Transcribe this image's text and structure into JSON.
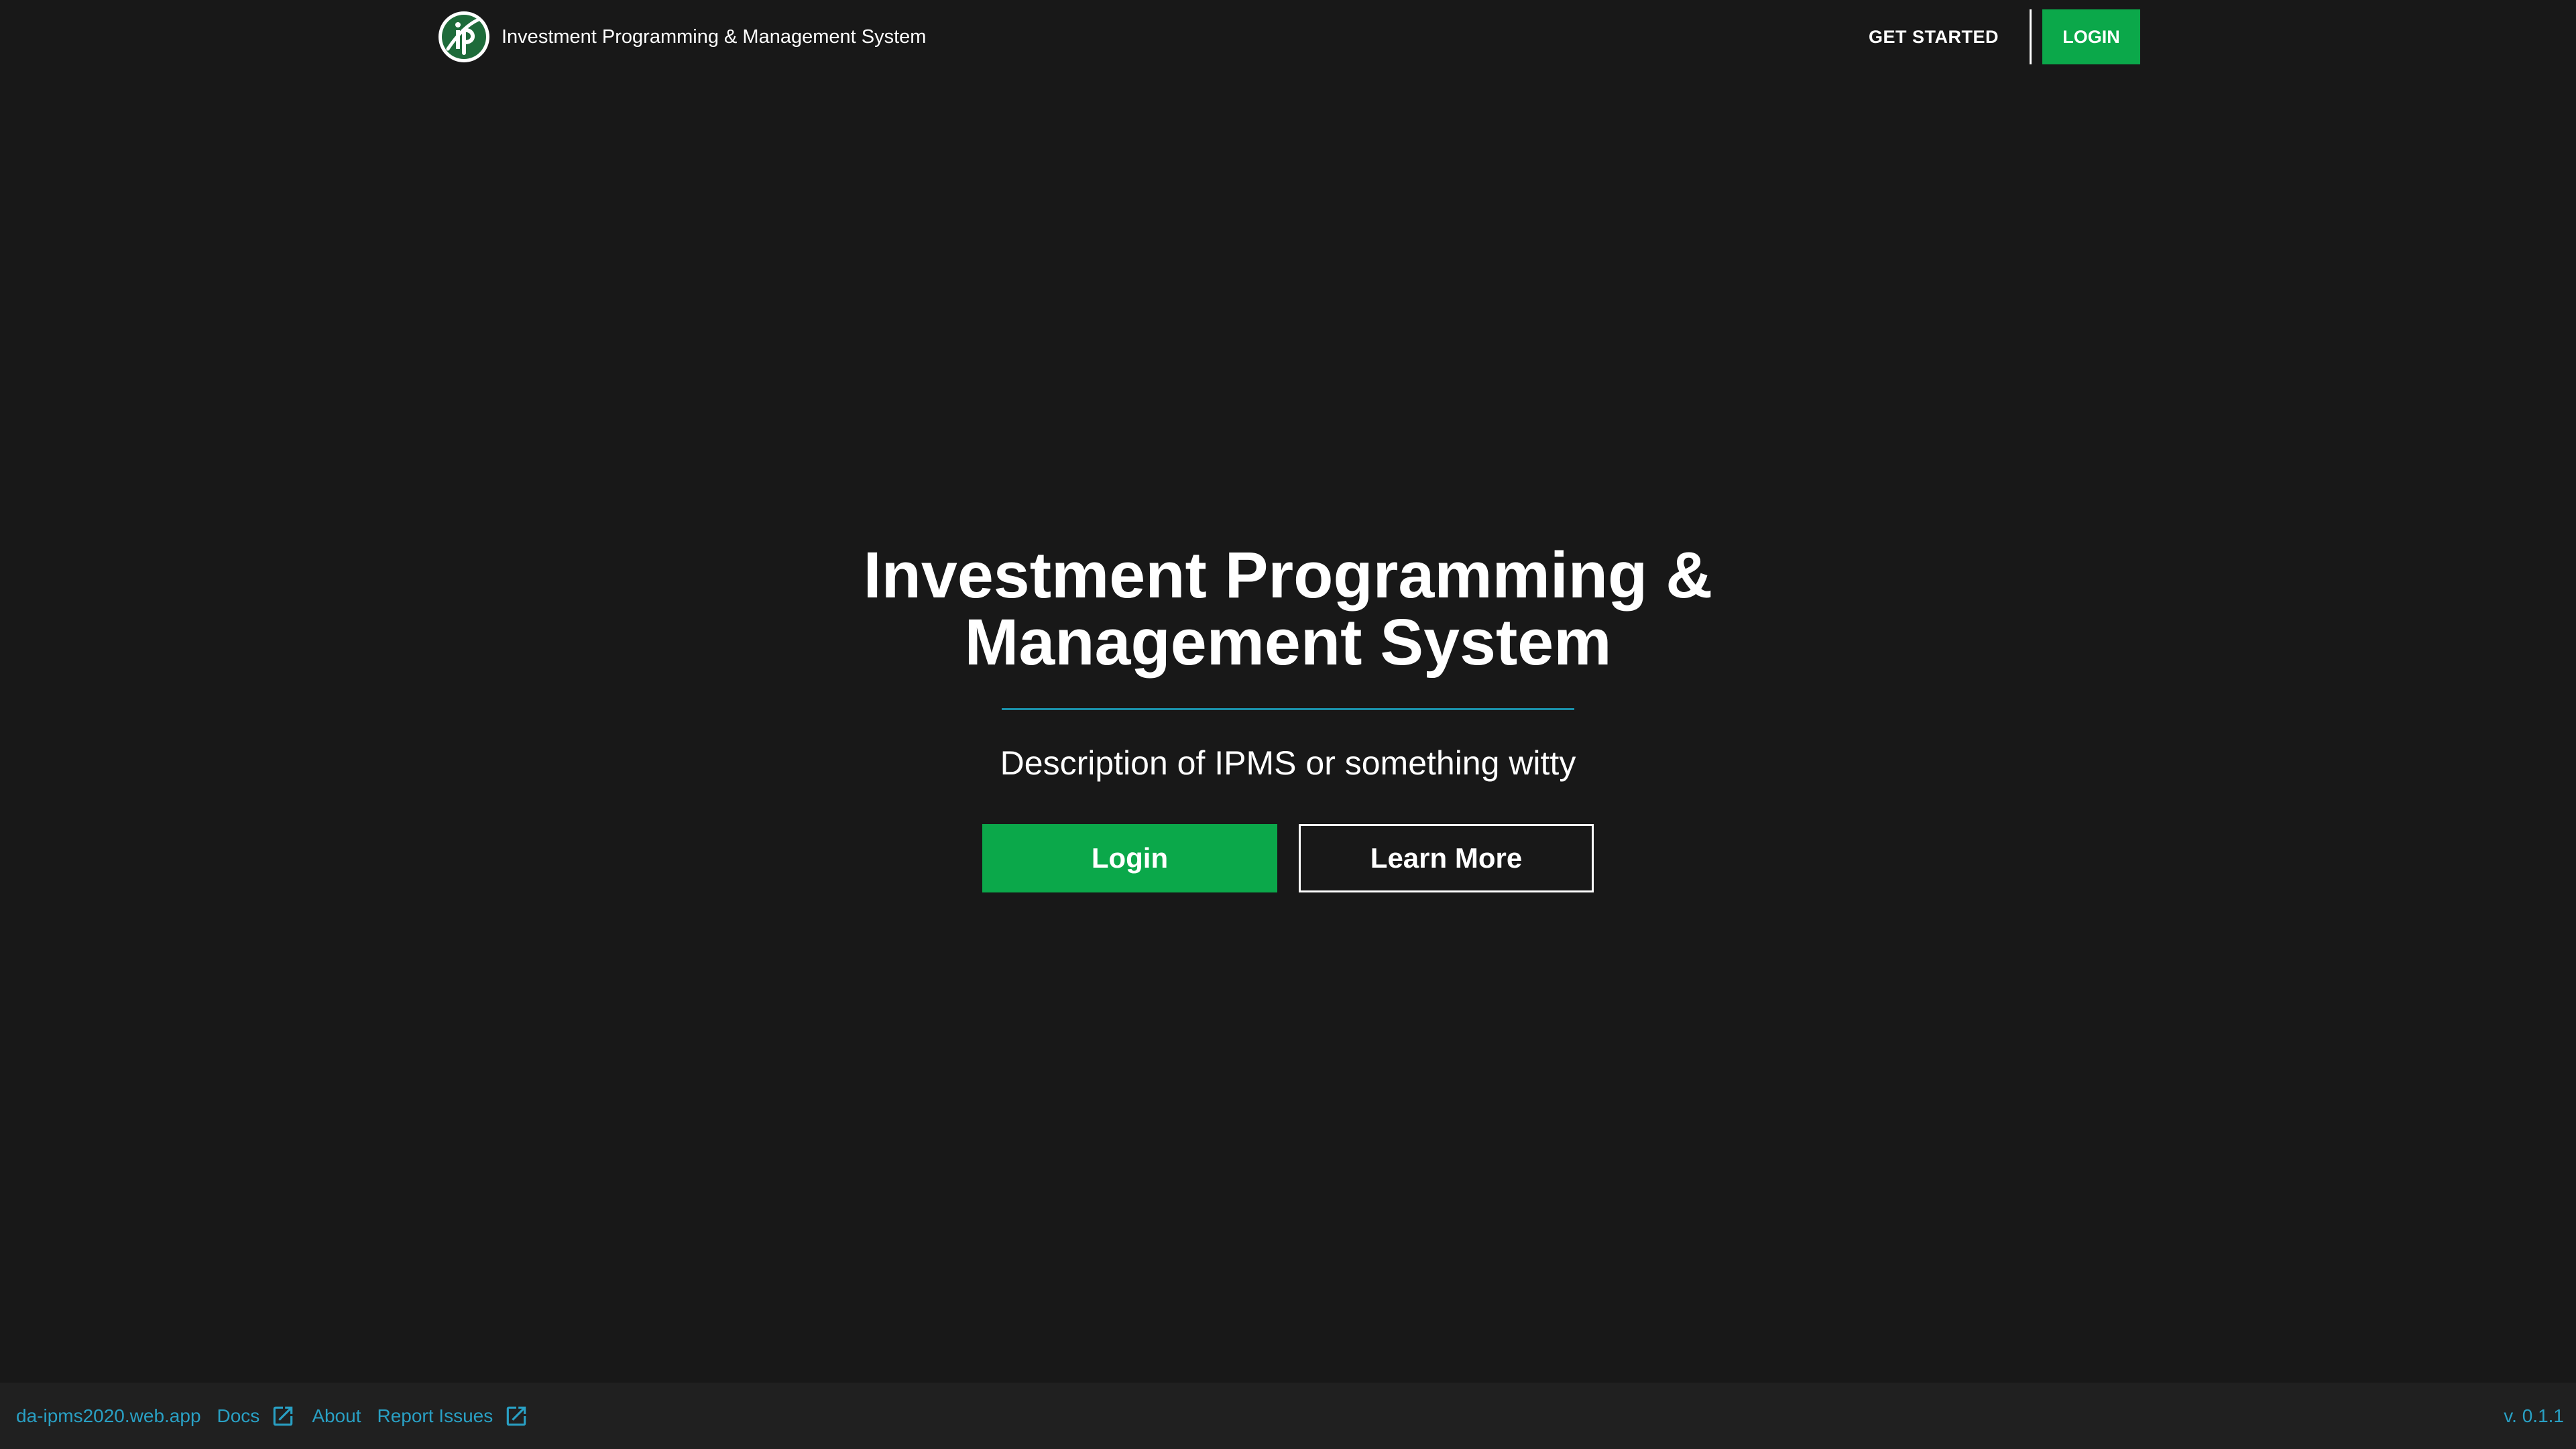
{
  "header": {
    "brand_title": "Investment Programming & Management System",
    "logo_icon": "ipms-logo-icon",
    "get_started_label": "GET STARTED",
    "login_label": "LOGIN"
  },
  "hero": {
    "title_line1": "Investment Programming &",
    "title_line2": "Management System",
    "description": "Description of IPMS or something witty",
    "login_button": "Login",
    "learn_more_button": "Learn More"
  },
  "footer": {
    "site_link": "da-ipms2020.web.app",
    "docs_link": "Docs",
    "about_link": "About",
    "report_issues_link": "Report Issues",
    "version": "v. 0.1.1",
    "external_icon": "open-in-new-icon"
  },
  "colors": {
    "background": "#181818",
    "accent_green": "#0ba84a",
    "link_blue": "#29a0c4",
    "divider_teal": "#1a8fa8",
    "footer_bg": "#202020"
  }
}
